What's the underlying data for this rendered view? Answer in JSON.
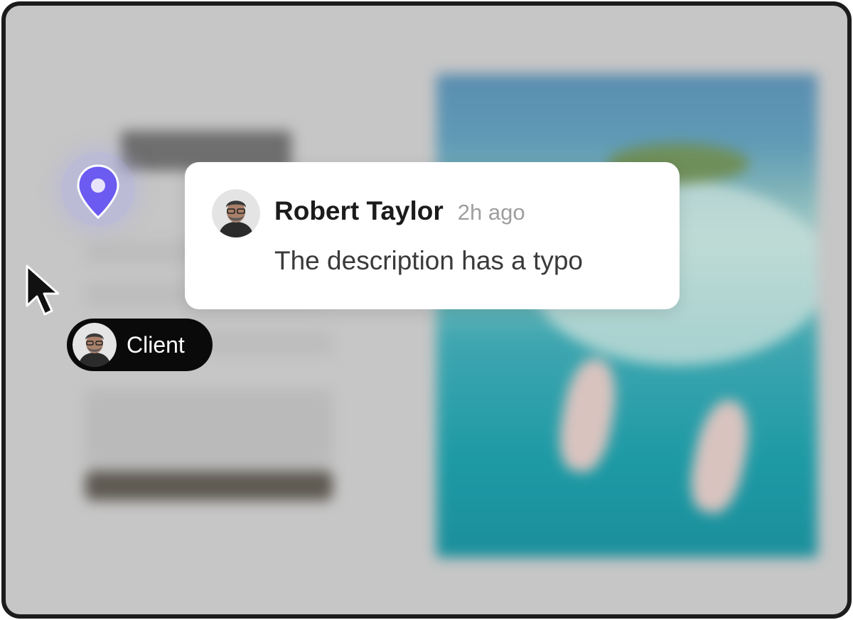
{
  "comment": {
    "author": "Robert Taylor",
    "time": "2h ago",
    "text": "The description has a typo"
  },
  "client_tag": {
    "label": "Client"
  },
  "icons": {
    "pin": "location-pin-icon",
    "cursor": "mouse-pointer-icon"
  },
  "colors": {
    "pin_accent": "#6b5bf0",
    "pin_halo": "#b0ace8",
    "tag_background": "#0a0a0a",
    "card_background": "#ffffff",
    "frame_border": "#1c1c1c"
  }
}
